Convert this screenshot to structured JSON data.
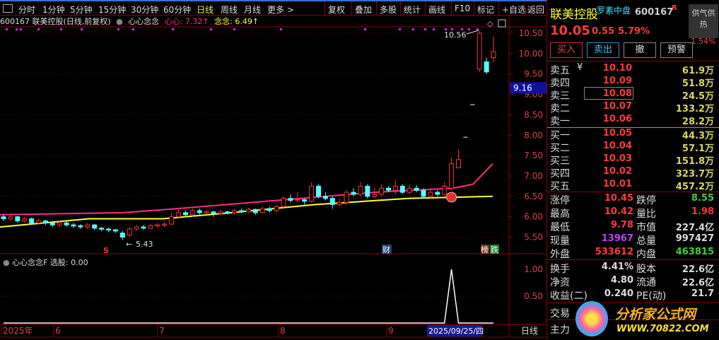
{
  "toolbar": {
    "periods": [
      "分时",
      "1分钟",
      "5分钟",
      "15分钟",
      "30分钟",
      "60分钟",
      "日线",
      "周线",
      "月线",
      "更多 >"
    ],
    "active_period": "日线",
    "buttons": [
      "复权",
      "叠加",
      "多股",
      "统计",
      "画线",
      "F10",
      "标记",
      "+自选",
      "返回"
    ]
  },
  "info": {
    "title": "600167 联美控股(日线,前复权)",
    "indicator": "心心念念",
    "line1_label": "心心:",
    "line1_value": "7.32↑",
    "line2_label": "念念:",
    "line2_value": "6.49↑"
  },
  "colors": {
    "up": "#ff3232",
    "down": "#54ffff",
    "ma1": "#ff2a8a",
    "ma2": "#ffff30",
    "grid": "#8b0000",
    "accent": "#ff3232"
  },
  "chart_data": {
    "type": "candlestick",
    "price_ticks": [
      "10.50",
      "10.00",
      "9.50",
      "9.00",
      "8.50",
      "8.00",
      "7.50",
      "7.00",
      "6.50",
      "6.00",
      "5.50"
    ],
    "current_price_tag": "9.16",
    "high_label": "10.56",
    "low_label": "5.43",
    "candles": [
      [
        6.0,
        5.95,
        6.05,
        5.9
      ],
      [
        5.95,
        6.0,
        6.05,
        5.9
      ],
      [
        6.0,
        5.9,
        6.02,
        5.85
      ],
      [
        5.9,
        5.95,
        6.0,
        5.85
      ],
      [
        5.95,
        5.85,
        5.98,
        5.8
      ],
      [
        5.85,
        5.9,
        5.95,
        5.8
      ],
      [
        5.9,
        5.85,
        5.92,
        5.8
      ],
      [
        5.85,
        5.8,
        5.9,
        5.75
      ],
      [
        5.8,
        5.85,
        5.9,
        5.75
      ],
      [
        5.85,
        5.8,
        5.88,
        5.75
      ],
      [
        5.8,
        5.78,
        5.85,
        5.72
      ],
      [
        5.78,
        5.75,
        5.82,
        5.7
      ],
      [
        5.75,
        5.8,
        5.85,
        5.7
      ],
      [
        5.8,
        5.72,
        5.82,
        5.68
      ],
      [
        5.72,
        5.7,
        5.75,
        5.65
      ],
      [
        5.7,
        5.68,
        5.73,
        5.62
      ],
      [
        5.68,
        5.65,
        5.7,
        5.6
      ],
      [
        5.6,
        5.5,
        5.65,
        5.43
      ],
      [
        5.55,
        5.7,
        5.75,
        5.5
      ],
      [
        5.7,
        5.75,
        5.8,
        5.65
      ],
      [
        5.75,
        5.72,
        5.8,
        5.68
      ],
      [
        5.72,
        5.78,
        5.82,
        5.7
      ],
      [
        5.78,
        5.8,
        5.85,
        5.72
      ],
      [
        5.8,
        5.82,
        5.88,
        5.75
      ],
      [
        5.82,
        6.0,
        6.1,
        5.8
      ],
      [
        6.0,
        6.1,
        6.2,
        5.95
      ],
      [
        6.1,
        6.05,
        6.15,
        6.0
      ],
      [
        6.05,
        6.15,
        6.2,
        6.0
      ],
      [
        6.15,
        6.1,
        6.2,
        6.05
      ],
      [
        6.1,
        6.12,
        6.18,
        6.05
      ],
      [
        6.12,
        6.08,
        6.15,
        6.0
      ],
      [
        6.08,
        6.12,
        6.18,
        6.05
      ],
      [
        6.12,
        6.1,
        6.15,
        6.05
      ],
      [
        6.1,
        6.15,
        6.2,
        6.05
      ],
      [
        6.15,
        6.12,
        6.2,
        6.08
      ],
      [
        6.12,
        6.18,
        6.22,
        6.1
      ],
      [
        6.18,
        6.1,
        6.2,
        6.05
      ],
      [
        6.1,
        6.2,
        6.25,
        6.08
      ],
      [
        6.2,
        6.15,
        6.25,
        6.1
      ],
      [
        6.15,
        6.25,
        6.3,
        6.1
      ],
      [
        6.25,
        6.45,
        6.5,
        6.2
      ],
      [
        6.45,
        6.4,
        6.55,
        6.35
      ],
      [
        6.4,
        6.42,
        6.6,
        6.35
      ],
      [
        6.42,
        6.38,
        6.45,
        6.3
      ],
      [
        6.38,
        6.75,
        6.85,
        6.35
      ],
      [
        6.75,
        6.5,
        6.8,
        6.45
      ],
      [
        6.5,
        6.45,
        6.6,
        6.4
      ],
      [
        6.45,
        6.3,
        6.5,
        6.2
      ],
      [
        6.3,
        6.35,
        6.45,
        6.25
      ],
      [
        6.35,
        6.6,
        6.65,
        6.3
      ],
      [
        6.6,
        6.55,
        6.7,
        6.5
      ],
      [
        6.55,
        6.75,
        6.85,
        6.5
      ],
      [
        6.75,
        6.5,
        6.8,
        6.45
      ],
      [
        6.5,
        6.55,
        6.7,
        6.45
      ],
      [
        6.55,
        6.7,
        6.8,
        6.5
      ],
      [
        6.7,
        6.65,
        6.75,
        6.6
      ],
      [
        6.65,
        6.75,
        6.9,
        6.55
      ],
      [
        6.75,
        6.6,
        6.8,
        6.55
      ],
      [
        6.6,
        6.7,
        6.8,
        6.55
      ],
      [
        6.7,
        6.65,
        6.78,
        6.6
      ],
      [
        6.65,
        6.5,
        6.7,
        6.45
      ],
      [
        6.5,
        6.6,
        6.7,
        6.45
      ],
      [
        6.6,
        6.55,
        6.65,
        6.5
      ],
      [
        6.55,
        6.75,
        6.85,
        6.5
      ],
      [
        6.7,
        7.3,
        7.45,
        6.65
      ],
      [
        7.2,
        7.4,
        7.65,
        7.2
      ],
      [
        7.95,
        7.95,
        7.95,
        7.95
      ],
      [
        8.75,
        8.75,
        8.75,
        8.75
      ],
      [
        9.62,
        10.5,
        10.56,
        9.55
      ],
      [
        9.8,
        9.55,
        9.9,
        9.5
      ],
      [
        9.9,
        10.05,
        10.42,
        9.78
      ]
    ],
    "ma1": [
      [
        0,
        6.05
      ],
      [
        25,
        6.1
      ],
      [
        36,
        6.2
      ],
      [
        56,
        6.4
      ],
      [
        76,
        6.6
      ],
      [
        92,
        6.7
      ],
      [
        96,
        6.8
      ],
      [
        100,
        7.3
      ]
    ],
    "ma2": [
      [
        0,
        5.75
      ],
      [
        18,
        5.95
      ],
      [
        33,
        5.95
      ],
      [
        47,
        6.1
      ],
      [
        64,
        6.3
      ],
      [
        83,
        6.45
      ],
      [
        100,
        6.5
      ]
    ],
    "lower": {
      "title": "心心念念F",
      "value_label": "选股: 0.00",
      "ticks": [
        "1.00",
        "0.50"
      ],
      "signal": [
        0,
        0,
        0,
        0,
        0,
        0,
        0,
        0,
        0,
        0,
        0,
        0,
        0,
        0,
        0,
        0,
        0,
        0,
        0,
        0,
        0,
        0,
        0,
        0,
        0,
        0,
        0,
        0,
        0,
        0,
        0,
        0,
        0,
        0,
        0,
        0,
        0,
        0,
        0,
        0,
        0,
        0,
        0,
        0,
        0,
        0,
        0,
        0,
        0,
        0,
        0,
        0,
        0,
        0,
        0,
        0,
        0,
        0,
        0,
        0,
        0,
        0,
        0,
        0,
        1,
        0,
        0,
        0,
        0,
        0,
        0
      ]
    },
    "date_axis": [
      "2025年",
      "6",
      "7",
      "8",
      "9"
    ],
    "selected_date": "2025/09/25/四",
    "period_label": "日线",
    "markers": {
      "s": "S",
      "cai": "财",
      "bang": "榜",
      "die": "跌"
    }
  },
  "panel": {
    "name": "联美控股",
    "tag": "罗素中盘",
    "code": "600167",
    "flag": "R",
    "price": "10.05",
    "change": "0.55",
    "pct": "5.79%",
    "side_title": "供气供热",
    "side_pct": "1.54%",
    "buy": "买入",
    "sell": "卖出",
    "cancel": "撤",
    "alert": "预警",
    "asks": [
      {
        "l": "卖五",
        "p": "10.10",
        "v": "61.9万"
      },
      {
        "l": "卖四",
        "p": "10.09",
        "v": "51.8万"
      },
      {
        "l": "卖三",
        "p": "10.08",
        "v": "24.5万"
      },
      {
        "l": "卖二",
        "p": "10.07",
        "v": "133.2万"
      },
      {
        "l": "卖一",
        "p": "10.06",
        "v": "28.2万"
      }
    ],
    "yen": "¥",
    "bids": [
      {
        "l": "买一",
        "p": "10.05",
        "v": "44.3万"
      },
      {
        "l": "买二",
        "p": "10.04",
        "v": "57.1万"
      },
      {
        "l": "买三",
        "p": "10.03",
        "v": "151.8万"
      },
      {
        "l": "买四",
        "p": "10.02",
        "v": "323.7万"
      },
      {
        "l": "买五",
        "p": "10.01",
        "v": "457.2万"
      }
    ],
    "stats": [
      {
        "a": "涨停",
        "b": "10.45",
        "bc": "#ff3b3b",
        "c": "跌停",
        "d": "8.55",
        "dc": "#40d040"
      },
      {
        "a": "最高",
        "b": "10.42",
        "bc": "#ff3b3b",
        "c": "量比",
        "d": "1.98",
        "dc": "#ff3b3b"
      },
      {
        "a": "最低",
        "b": "9.78",
        "bc": "#ff3b3b",
        "c": "市值",
        "d": "227.4亿",
        "dc": "#ddd"
      },
      {
        "a": "现量",
        "b": "13967",
        "bc": "#c040ff",
        "c": "总量",
        "d": "997427",
        "dc": "#ddd"
      },
      {
        "a": "外盘",
        "b": "533612",
        "bc": "#ff3b3b",
        "c": "内盘",
        "d": "463815",
        "dc": "#40d040"
      }
    ],
    "fin": [
      {
        "a": "换手",
        "b": "4.41%",
        "c": "股本",
        "d": "22.6亿"
      },
      {
        "a": "净资",
        "b": "4.80",
        "c": "流通",
        "d": "22.6亿"
      },
      {
        "a": "收益(二)",
        "b": "0.240",
        "c": "PE(动)",
        "d": "21.7"
      }
    ],
    "bottom": [
      "交易",
      "主力"
    ],
    "watermark": {
      "title": "分析家公式网",
      "url": "WWW.70822.COM"
    }
  }
}
